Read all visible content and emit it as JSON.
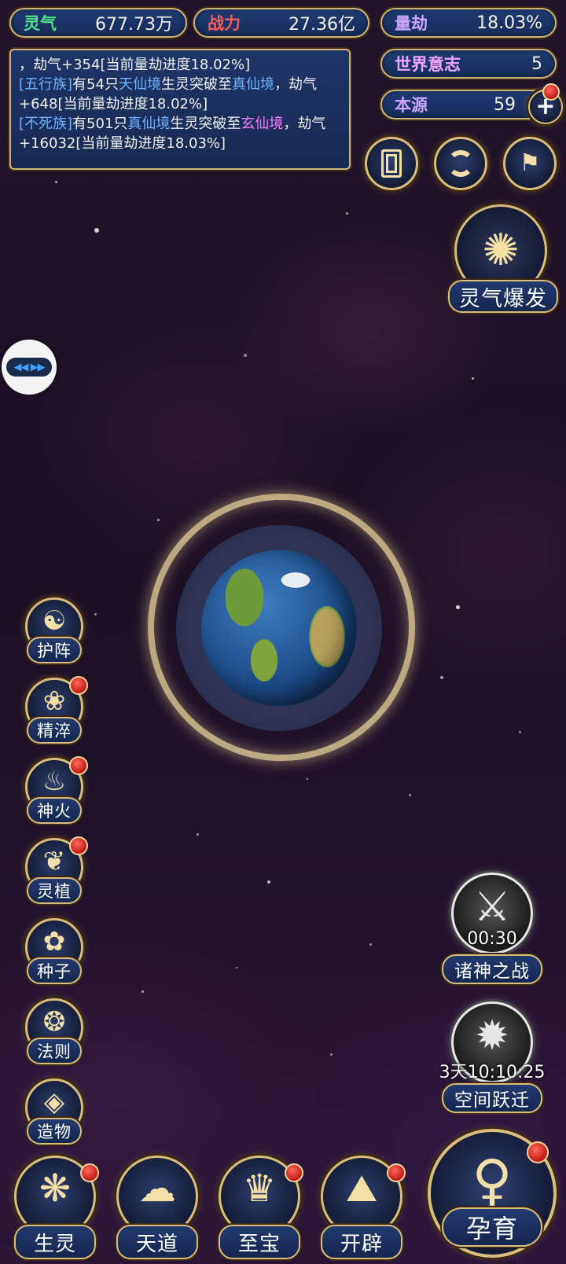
{
  "stats": {
    "lingqi": {
      "label": "灵气",
      "value": "677.73万"
    },
    "zhanli": {
      "label": "战力",
      "value": "27.36亿"
    },
    "liangjie": {
      "label": "量劫",
      "value": "18.03%"
    },
    "shijie": {
      "label": "世界意志",
      "value": "5"
    },
    "benyuan": {
      "label": "本源",
      "value": "59"
    }
  },
  "log": {
    "line1": "，劫气+354[当前量劫进度18.02%]",
    "e2_tribe": "[五行族]",
    "e2_a": "有54只",
    "e2_from": "天仙境",
    "e2_b": "生灵突破至",
    "e2_to": "真仙境",
    "e2_c": "，劫气+648[当前量劫进度18.02%]",
    "e3_tribe": "[不死族]",
    "e3_a": "有501只",
    "e3_from": "真仙境",
    "e3_b": "生灵突破至",
    "e3_to": "玄仙境",
    "e3_c": "，劫气+16032[当前量劫进度18.03%]"
  },
  "right": {
    "burst_label": "灵气爆发",
    "gods_war": {
      "timer": "00:30",
      "label": "诸神之战"
    },
    "space_jump": {
      "timer": "3天10:10:25",
      "label": "空间跃迁"
    }
  },
  "left_menu": [
    "护阵",
    "精淬",
    "神火",
    "灵植",
    "种子",
    "法则",
    "造物"
  ],
  "bottom_menu": [
    "生灵",
    "天道",
    "至宝",
    "开辟"
  ],
  "main_button": "孕育"
}
